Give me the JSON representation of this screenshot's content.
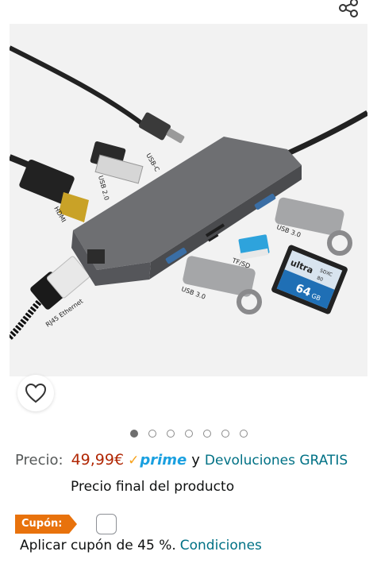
{
  "product_image": {
    "labels": {
      "usb_c": "USB-C",
      "usb_2": "USB 2.0",
      "hdmi": "HDMI",
      "rj45": "RJ45 Ethernet",
      "usb_3_top": "USB 3.0",
      "usb_3_bottom": "USB 3.0",
      "tf_sd": "TF/SD",
      "sd_card_brand": "ultra",
      "sd_card_capacity": "64",
      "sd_card_unit": "GB",
      "sd_card_class": "SDXC",
      "sd_card_speed": "80"
    }
  },
  "carousel": {
    "count": 7,
    "active_index": 0
  },
  "price": {
    "label": "Precio:",
    "value": "49,99€",
    "prime_check": "✓",
    "prime_label": "prime",
    "conjunction": "y",
    "returns_link": "Devoluciones GRATIS",
    "final_note": "Precio final del producto"
  },
  "coupon": {
    "badge": "Cupón:",
    "text": "Aplicar cupón de 45 %.",
    "conditions_link": "Condiciones",
    "checked": false
  },
  "icons": {
    "share": "share-icon",
    "wishlist": "heart-icon"
  },
  "colors": {
    "price": "#b12704",
    "link": "#007185",
    "prime": "#1aa0e0",
    "coupon_badge": "#e8720c"
  }
}
